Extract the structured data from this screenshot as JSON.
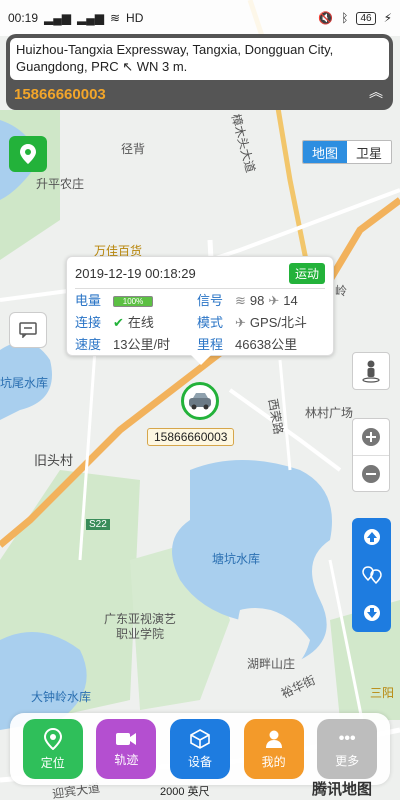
{
  "status": {
    "time": "00:19",
    "network": "HD",
    "battery": "46"
  },
  "address": {
    "text": "Huizhou-Tangxia Expressway, Tangxia, Dongguan City, Guangdong, PRC ↖ WN 3 m.",
    "phone": "15866660003"
  },
  "map_type": {
    "map": "地图",
    "satellite": "卫星"
  },
  "map_labels": {
    "jingbei": "径背",
    "shengping": "升平农庄",
    "wanjia": "万佳百货",
    "hangwei": "坑尾水库",
    "jiutou": "旧头村",
    "xirong": "西荣路",
    "lincun": "林村广场",
    "tangkeng": "塘坑水库",
    "s22": "S22",
    "guangdong_yashi": "广东亚视演艺\n职业学院",
    "hupan": "湖畔山庄",
    "yuhua": "裕华街",
    "dazhongling": "大钟岭水库",
    "sanyang": "三阳",
    "zhangmu": "樟木头大道",
    "ling": "岭",
    "scale": "2000 英尺",
    "tencent": "腾讯地图",
    "road_bottom": "迎宾大道"
  },
  "popup": {
    "time": "2019-12-19 00:18:29",
    "motion": "运动",
    "rows": [
      {
        "k1": "电量",
        "v1": "100%",
        "k2": "信号",
        "v2a": "98",
        "v2b": "14"
      },
      {
        "k1": "连接",
        "v1": "在线",
        "k2": "模式",
        "v2": "GPS/北斗"
      },
      {
        "k1": "速度",
        "v1": "13公里/时",
        "k2": "里程",
        "v2": "46638公里"
      }
    ]
  },
  "car": {
    "label": "15866660003"
  },
  "bottom_nav": [
    {
      "label": "定位",
      "icon": "location-pin-icon",
      "color": "#2fbf5a"
    },
    {
      "label": "轨迹",
      "icon": "video-icon",
      "color": "#b44fd0"
    },
    {
      "label": "设备",
      "icon": "cube-icon",
      "color": "#1e7ce0"
    },
    {
      "label": "我的",
      "icon": "user-icon",
      "color": "#f39a2a"
    },
    {
      "label": "更多",
      "icon": "more-icon",
      "color": "#bdbdbd"
    }
  ]
}
